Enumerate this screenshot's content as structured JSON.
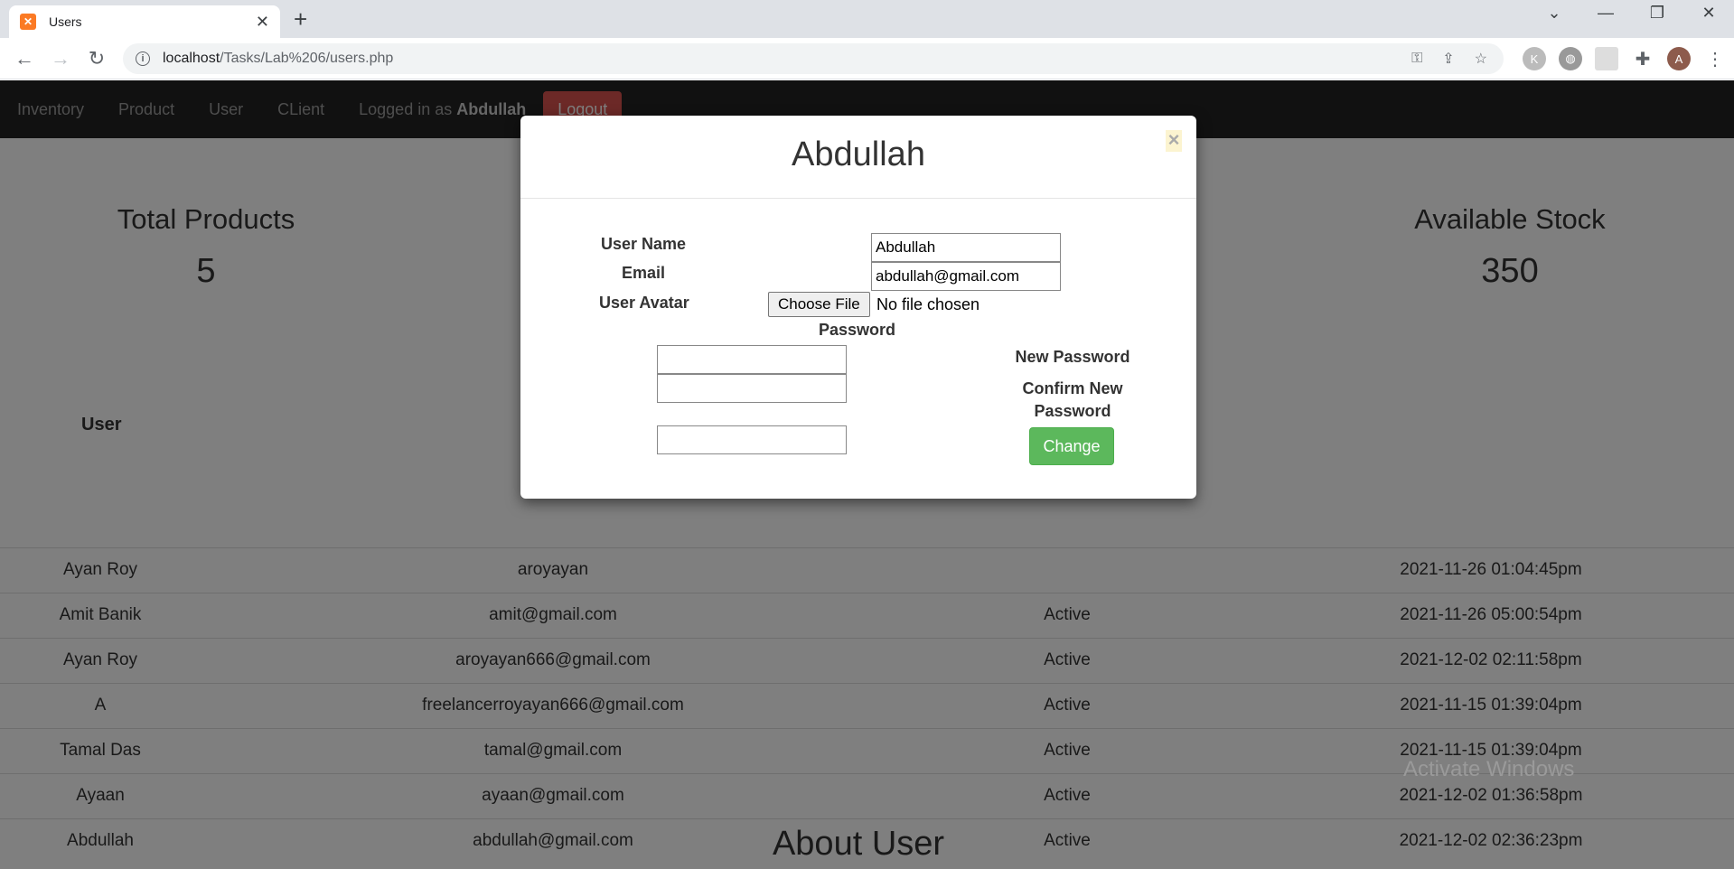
{
  "browser": {
    "tab_title": "Users",
    "favicon": "xampp-icon",
    "url_host": "localhost",
    "url_path": "/Tasks/Lab%206/users.php",
    "profile_initial": "A"
  },
  "nav": {
    "items": [
      "Inventory",
      "Product",
      "User",
      "CLient"
    ],
    "logged_in_prefix": "Logged in as",
    "logged_in_user": "Abdullah",
    "logout_label": "Logout"
  },
  "stats": {
    "left_title": "Total Products",
    "left_value": "5",
    "right_title": "Available Stock",
    "right_value": "350"
  },
  "table": {
    "header_user": "User",
    "rows": [
      {
        "user": "Ayan Roy",
        "email": "aroyayan",
        "status": "",
        "date": "2021-11-26 01:04:45pm"
      },
      {
        "user": "Amit Banik",
        "email": "amit@gmail.com",
        "status": "Active",
        "date": "2021-11-26 05:00:54pm"
      },
      {
        "user": "Ayan Roy",
        "email": "aroyayan666@gmail.com",
        "status": "Active",
        "date": "2021-12-02 02:11:58pm"
      },
      {
        "user": "A",
        "email": "freelancerroyayan666@gmail.com",
        "status": "Active",
        "date": "2021-11-15 01:39:04pm"
      },
      {
        "user": "Tamal Das",
        "email": "tamal@gmail.com",
        "status": "Active",
        "date": "2021-11-15 01:39:04pm"
      },
      {
        "user": "Ayaan",
        "email": "ayaan@gmail.com",
        "status": "Active",
        "date": "2021-12-02 01:36:58pm"
      },
      {
        "user": "Abdullah",
        "email": "abdullah@gmail.com",
        "status": "Active",
        "date": "2021-12-02 02:36:23pm"
      }
    ]
  },
  "about_title": "About User",
  "watermark": "Activate Windows",
  "modal": {
    "title": "Abdullah",
    "close_label": "×",
    "username_label": "User Name",
    "username_value": "Abdullah",
    "email_label": "Email",
    "email_value": "abdullah@gmail.com",
    "avatar_label": "User Avatar",
    "choose_file_label": "Choose File",
    "no_file_text": "No file chosen",
    "password_label": "Password",
    "new_password_label": "New Password",
    "confirm_password_label": "Confirm New Password",
    "change_label": "Change"
  }
}
